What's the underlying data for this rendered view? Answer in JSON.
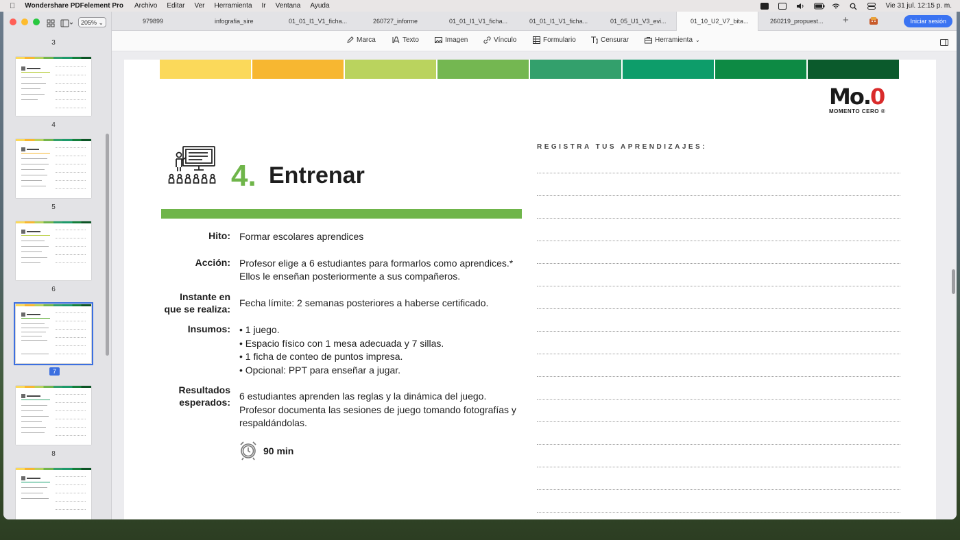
{
  "menubar": {
    "app_name": "Wondershare PDFelement Pro",
    "menus": [
      "Archivo",
      "Editar",
      "Ver",
      "Herramienta",
      "Ir",
      "Ventana",
      "Ayuda"
    ],
    "clock": "Vie 31 jul.  12:15 p. m."
  },
  "sidebar": {
    "zoom": "205%",
    "page_labels": [
      "3",
      "4",
      "5",
      "6",
      "7",
      "8"
    ],
    "selected_page": "7"
  },
  "tabs": [
    "979899",
    "infografia_sire",
    "01_01_I1_V1_ficha...",
    "260727_informe",
    "01_01_I1_V1_ficha...",
    "01_01_I1_V1_ficha...",
    "01_05_U1_V3_evi...",
    "01_10_U2_V7_bita...",
    "260219_propuest..."
  ],
  "active_tab_index": 7,
  "login_label": "Iniciar sesión",
  "toolbar": {
    "items": [
      {
        "label": "Marca",
        "icon": "marker-icon"
      },
      {
        "label": "Texto",
        "icon": "text-icon"
      },
      {
        "label": "Imagen",
        "icon": "image-icon"
      },
      {
        "label": "Vínculo",
        "icon": "link-icon"
      },
      {
        "label": "Formulario",
        "icon": "form-icon"
      },
      {
        "label": "Censurar",
        "icon": "redact-icon"
      },
      {
        "label": "Herramienta",
        "icon": "toolbox-icon"
      }
    ]
  },
  "document": {
    "band_colors": [
      "#fbd95a",
      "#f7b731",
      "#bad35e",
      "#74b751",
      "#33a06c",
      "#0d9d6a",
      "#0d8a44",
      "#0b5a2c"
    ],
    "logo_main": "Mo.",
    "logo_zero": "0",
    "logo_sub": "MOMENTO CERO ®",
    "step_number": "4.",
    "step_title": "Entrenar",
    "fields": {
      "hito_label": "Hito:",
      "hito_value": "Formar escolares aprendices",
      "accion_label": "Acción:",
      "accion_line1": "Profesor elige a 6 estudiantes para formarlos como aprendices.*",
      "accion_line2": "Ellos le enseñan posteriormente a sus compañeros.",
      "instante_label1": "Instante en",
      "instante_label2": "que se realiza:",
      "instante_value": "Fecha límite: 2 semanas posteriores a haberse certificado.",
      "insumos_label": "Insumos:",
      "insumos_items": [
        "• 1 juego.",
        "• Espacio físico con 1 mesa adecuada y 7 sillas.",
        "• 1 ficha de conteo de puntos impresa.",
        "• Opcional: PPT para enseñar a jugar."
      ],
      "resultados_label1": "Resultados",
      "resultados_label2": "esperados:",
      "resultados_line1": "6 estudiantes aprenden las reglas y la dinámica del juego.",
      "resultados_line2": "Profesor documenta las sesiones de juego tomando fotografías y",
      "resultados_line3": "respaldándolas."
    },
    "duration": "90 min",
    "register_heading": "REGISTRA TUS APRENDIZAJES:"
  }
}
